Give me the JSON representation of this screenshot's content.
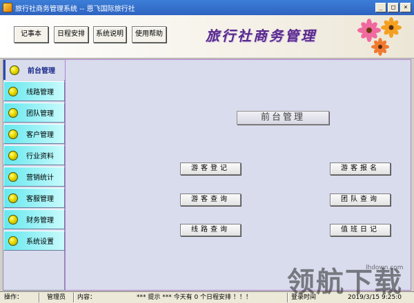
{
  "window": {
    "title": "旅行社商务管理系统 -- 恩飞国际旅行社",
    "minimize": "_",
    "maximize": "□",
    "close": "×"
  },
  "toolbar": {
    "notebook": "记事本",
    "schedule": "日程安排",
    "system_info": "系统说明",
    "help": "使用帮助"
  },
  "brand": {
    "title": "旅行社商务管理"
  },
  "sidebar": {
    "items": [
      {
        "label": "前台管理"
      },
      {
        "label": "线路管理"
      },
      {
        "label": "团队管理"
      },
      {
        "label": "客户管理"
      },
      {
        "label": "行业资料"
      },
      {
        "label": "营销统计"
      },
      {
        "label": "客服管理"
      },
      {
        "label": "财务管理"
      },
      {
        "label": "系统设置"
      }
    ]
  },
  "main": {
    "section_title": "前台管理",
    "buttons": {
      "guest_register": "游客登记",
      "guest_signup": "游客报名",
      "guest_query": "游客查询",
      "team_query": "团队查询",
      "route_query": "线路查询",
      "duty_log": "值班日记"
    }
  },
  "status": {
    "operation_label": "操作：",
    "operator": "管理员",
    "content_label": "内容：",
    "message": "*** 提示 ***   今天有 0 个日程安排 ！！！",
    "time_label": "登录时间",
    "time_value": "2019/3/15 9:25:0"
  },
  "watermark": {
    "big": "领航下载",
    "small": "lhdown.com"
  },
  "colors": {
    "titlebar": "#2e63c0",
    "sidebar_item": "#66e8ee",
    "panel": "#d8dcec",
    "brand": "#5a2a8a"
  }
}
